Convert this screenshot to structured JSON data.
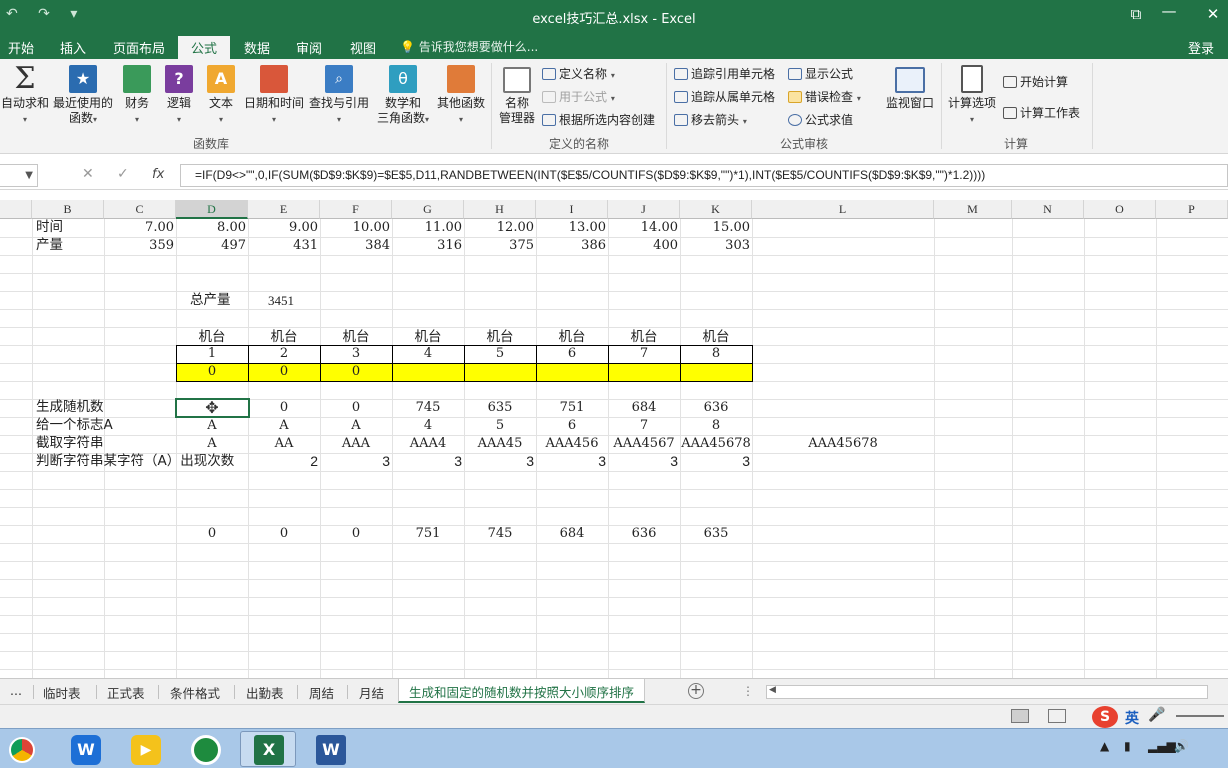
{
  "window": {
    "title": "excel技巧汇总.xlsx - Excel",
    "restore_label": "⧉",
    "minimize_label": "—",
    "close_label": "✕"
  },
  "quick_access": "↶ ↷ ▾",
  "ribbon_tabs": [
    "开始",
    "插入",
    "页面布局",
    "公式",
    "数据",
    "审阅",
    "视图"
  ],
  "active_tab": "公式",
  "tell_me": "告诉我您想要做什么...",
  "login": "登录",
  "ribbon": {
    "function_library": {
      "label": "函数库",
      "buttons": [
        "自动求和",
        "最近使用的\n函数",
        "财务",
        "逻辑",
        "文本",
        "日期和时间",
        "查找与引用",
        "数学和\n三角函数",
        "其他函数"
      ]
    },
    "defined_names": {
      "label": "定义的名称",
      "name_manager": "名称\n管理器",
      "define_name": "定义名称",
      "use_in_formula": "用于公式",
      "create_from_selection": "根据所选内容创建"
    },
    "formula_auditing": {
      "label": "公式审核",
      "trace_precedents": "追踪引用单元格",
      "trace_dependents": "追踪从属单元格",
      "remove_arrows": "移去箭头",
      "show_formulas": "显示公式",
      "error_checking": "错误检查",
      "evaluate_formula": "公式求值",
      "watch_window": "监视窗口"
    },
    "calculation": {
      "label": "计算",
      "options": "计算选项",
      "calc_now": "开始计算",
      "calc_sheet": "计算工作表"
    }
  },
  "formula_bar": {
    "cancel": "✕",
    "enter": "✓",
    "fx": "fx",
    "formula": "=IF(D9<>\"\",0,IF(SUM($D$9:$K$9)=$E$5,D11,RANDBETWEEN(INT($E$5/COUNTIFS($D$9:$K$9,\"\")*1),INT($E$5/COUNTIFS($D$9:$K$9,\"\")*1.2))))"
  },
  "columns": [
    "B",
    "C",
    "D",
    "E",
    "F",
    "G",
    "H",
    "I",
    "J",
    "K",
    "L",
    "M",
    "N",
    "O",
    "P"
  ],
  "sheet": {
    "row_time": {
      "label": "时间",
      "values": [
        "7.00",
        "8.00",
        "9.00",
        "10.00",
        "11.00",
        "12.00",
        "13.00",
        "14.00",
        "15.00"
      ]
    },
    "row_output": {
      "label": "产量",
      "values": [
        "359",
        "497",
        "431",
        "384",
        "316",
        "375",
        "386",
        "400",
        "303"
      ]
    },
    "total_label": "总产量",
    "total_value": "3451",
    "machine_label": "机台",
    "machine_numbers": [
      "1",
      "2",
      "3",
      "4",
      "5",
      "6",
      "7",
      "8"
    ],
    "yellow_values": [
      "0",
      "0",
      "0",
      "",
      "",
      "",
      "",
      ""
    ],
    "row_random": {
      "label": "生成随机数",
      "values": [
        "",
        "0",
        "0",
        "745",
        "635",
        "751",
        "684",
        "636"
      ]
    },
    "row_flag": {
      "label": "给一个标志A",
      "values": [
        "A",
        "A",
        "A",
        "4",
        "5",
        "6",
        "7",
        "8"
      ]
    },
    "row_substr": {
      "label": "截取字符串",
      "values": [
        "A",
        "AA",
        "AAA",
        "AAA4",
        "AAA45",
        "AAA456",
        "AAA4567",
        "AAA45678"
      ],
      "extra": "AAA45678"
    },
    "row_count": {
      "label": "判断字符串某字符（A）出现次数",
      "values": [
        "",
        "2",
        "3",
        "3",
        "3",
        "3",
        "3",
        "3"
      ]
    },
    "row_sorted": {
      "values": [
        "0",
        "0",
        "0",
        "751",
        "745",
        "684",
        "636",
        "635"
      ]
    }
  },
  "sheet_tabs": [
    "...",
    "临时表",
    "正式表",
    "条件格式",
    "出勤表",
    "周结",
    "月结",
    "生成和固定的随机数并按照大小顺序排序"
  ],
  "active_sheet": "生成和固定的随机数并按照大小顺序排序",
  "ime": "英",
  "colors": {
    "excel_green": "#217346",
    "highlight_yellow": "#ffff00"
  }
}
